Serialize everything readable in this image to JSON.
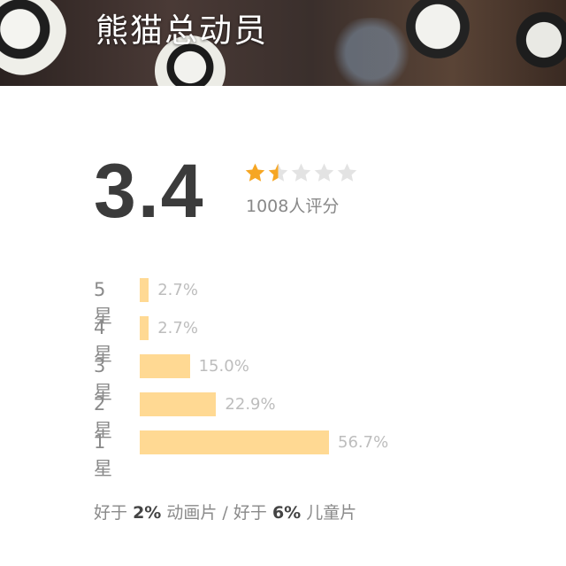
{
  "title": "熊猫总动员",
  "rating": {
    "score": "3.4",
    "stars_filled": 1.5,
    "stars_total": 5,
    "count_text": "1008人评分"
  },
  "distribution": [
    {
      "label": "5星",
      "percent": 2.7,
      "percent_text": "2.7%"
    },
    {
      "label": "4星",
      "percent": 2.7,
      "percent_text": "2.7%"
    },
    {
      "label": "3星",
      "percent": 15.0,
      "percent_text": "15.0%"
    },
    {
      "label": "2星",
      "percent": 22.9,
      "percent_text": "22.9%"
    },
    {
      "label": "1星",
      "percent": 56.7,
      "percent_text": "56.7%"
    }
  ],
  "comparison": {
    "part1_prefix": "好于",
    "part1_value": "2%",
    "part1_suffix": "动画片 /",
    "part2_prefix": "好于",
    "part2_value": "6%",
    "part2_suffix": "儿童片"
  },
  "colors": {
    "star_filled": "#f6a623",
    "star_empty": "#e3e3e3",
    "bar": "#ffd993"
  }
}
